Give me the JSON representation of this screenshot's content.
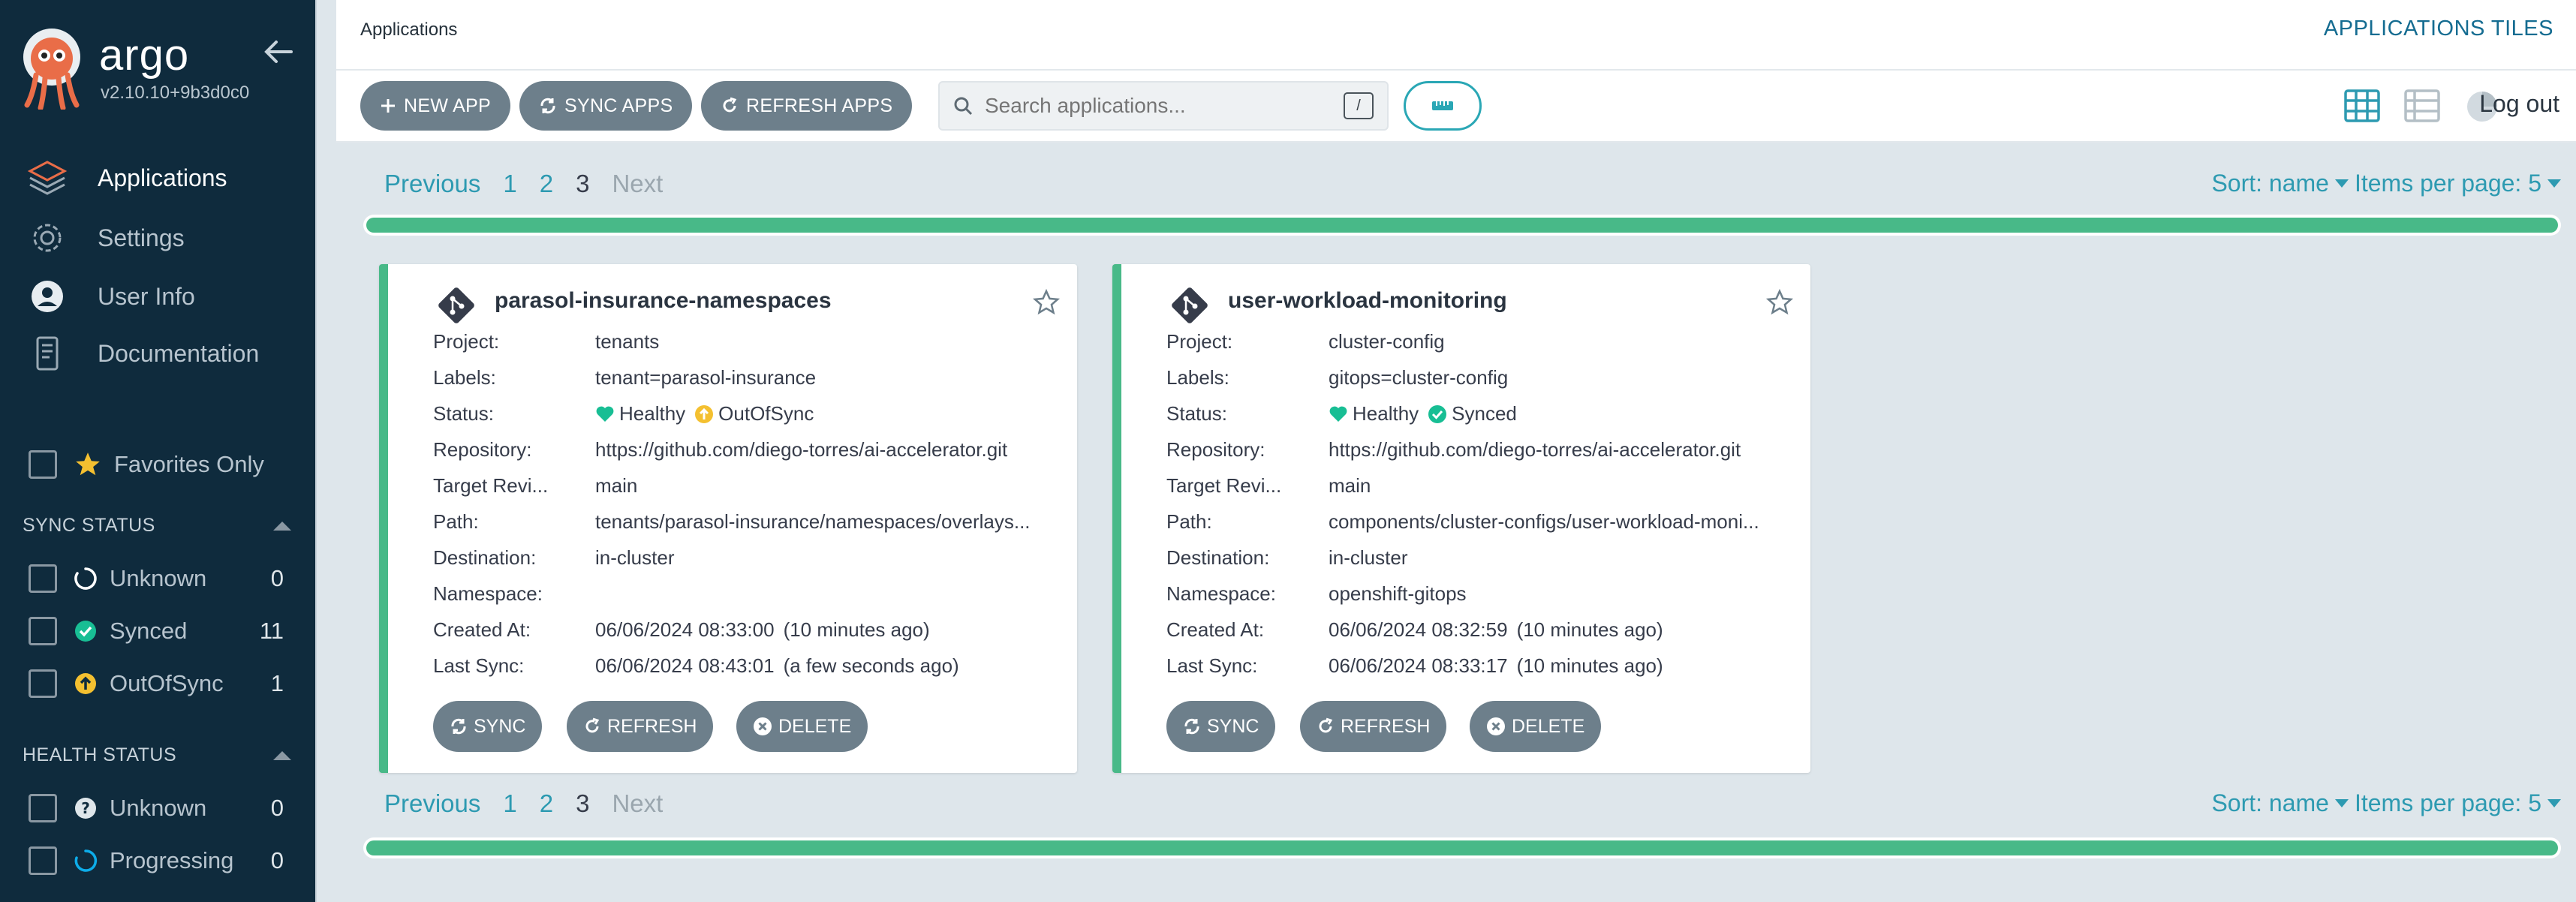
{
  "sidebar": {
    "logo_name": "argo",
    "version": "v2.10.10+9b3d0c0",
    "nav": [
      {
        "label": "Applications"
      },
      {
        "label": "Settings"
      },
      {
        "label": "User Info"
      },
      {
        "label": "Documentation"
      }
    ],
    "favorites_label": "Favorites Only",
    "sync_status": {
      "heading": "SYNC STATUS",
      "items": [
        {
          "label": "Unknown",
          "count": "0"
        },
        {
          "label": "Synced",
          "count": "11"
        },
        {
          "label": "OutOfSync",
          "count": "1"
        }
      ]
    },
    "health_status": {
      "heading": "HEALTH STATUS",
      "items": [
        {
          "label": "Unknown",
          "count": "0"
        },
        {
          "label": "Progressing",
          "count": "0"
        }
      ]
    }
  },
  "header": {
    "title": "Applications",
    "right_title": "APPLICATIONS TILES"
  },
  "toolbar": {
    "new_app": "NEW APP",
    "sync_apps": "SYNC APPS",
    "refresh_apps": "REFRESH APPS",
    "search_placeholder": "Search applications...",
    "search_shortcut": "/",
    "logout": "Log out"
  },
  "pagination": {
    "previous": "Previous",
    "pages": [
      "1",
      "2",
      "3"
    ],
    "current": "3",
    "next": "Next",
    "sort_label": "Sort: name",
    "items_label": "Items per page: 5"
  },
  "labels": {
    "project": "Project:",
    "labels": "Labels:",
    "status": "Status:",
    "repository": "Repository:",
    "target": "Target Revi...",
    "path": "Path:",
    "destination": "Destination:",
    "namespace": "Namespace:",
    "created": "Created At:",
    "last_sync": "Last Sync:",
    "sync_btn": "SYNC",
    "refresh_btn": "REFRESH",
    "delete_btn": "DELETE"
  },
  "colors": {
    "healthy": "#18be94",
    "synced": "#18be94",
    "out_of_sync": "#f4c030",
    "accent": "#2d9ab1"
  },
  "apps": [
    {
      "name": "parasol-insurance-namespaces",
      "project": "tenants",
      "labels": "tenant=parasol-insurance",
      "health": "Healthy",
      "sync": "OutOfSync",
      "repository": "https://github.com/diego-torres/ai-accelerator.git",
      "target": "main",
      "path": "tenants/parasol-insurance/namespaces/overlays...",
      "destination": "in-cluster",
      "namespace": "",
      "created": "06/06/2024 08:33:00",
      "created_ago": "(10 minutes ago)",
      "last_sync": "06/06/2024 08:43:01",
      "last_sync_ago": "(a few seconds ago)"
    },
    {
      "name": "user-workload-monitoring",
      "project": "cluster-config",
      "labels": "gitops=cluster-config",
      "health": "Healthy",
      "sync": "Synced",
      "repository": "https://github.com/diego-torres/ai-accelerator.git",
      "target": "main",
      "path": "components/cluster-configs/user-workload-moni...",
      "destination": "in-cluster",
      "namespace": "openshift-gitops",
      "created": "06/06/2024 08:32:59",
      "created_ago": "(10 minutes ago)",
      "last_sync": "06/06/2024 08:33:17",
      "last_sync_ago": "(10 minutes ago)"
    }
  ]
}
